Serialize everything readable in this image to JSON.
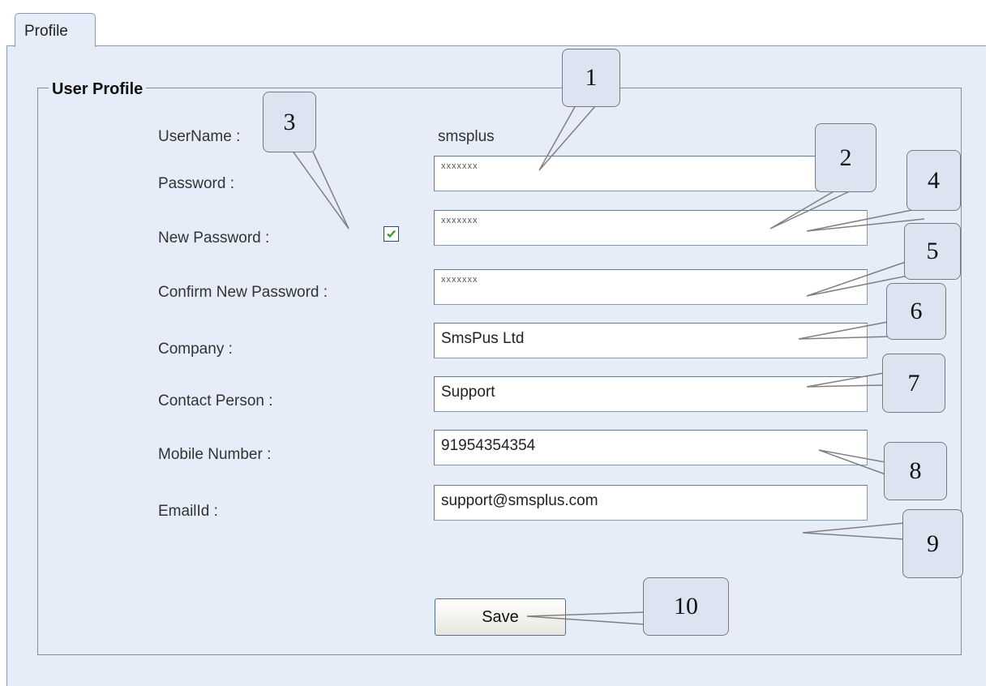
{
  "tab": {
    "label": "Profile"
  },
  "group": {
    "title": "User Profile"
  },
  "fields": {
    "username_label": "UserName :",
    "username_value": "smsplus",
    "password_label": "Password :",
    "password_value": "xxxxxxx",
    "new_password_label": "New Password :",
    "new_password_checked": true,
    "new_password_value": "xxxxxxx",
    "confirm_password_label": "Confirm New Password :",
    "confirm_password_value": "xxxxxxx",
    "company_label": "Company :",
    "company_value": "SmsPus Ltd",
    "contact_label": "Contact Person :",
    "contact_value": "Support",
    "mobile_label": "Mobile Number :",
    "mobile_value": "91954354354",
    "email_label": "EmailId :",
    "email_value": "support@smsplus.com"
  },
  "buttons": {
    "save_label": "Save"
  },
  "callouts": [
    "1",
    "2",
    "3",
    "4",
    "5",
    "6",
    "7",
    "8",
    "9",
    "10"
  ],
  "colors": {
    "panel_bg": "#e6ecf8",
    "checkbox_check": "#3c9a3c",
    "callout_bg": "#dce4f2"
  }
}
